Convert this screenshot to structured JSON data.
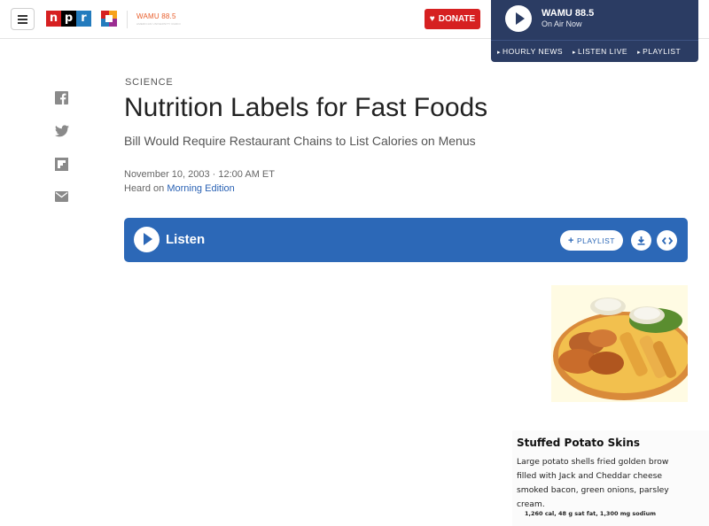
{
  "header": {
    "menu_icon": "hamburger-icon",
    "brand": {
      "n": "n",
      "p": "p",
      "r": "r"
    },
    "station_logo_text": "WAMU 88.5",
    "station_logo_tagline": "AMERICAN UNIVERSITY RADIO",
    "donate_label": "DONATE",
    "donate_icon": "heart-icon"
  },
  "player": {
    "station_name": "WAMU 88.5",
    "status": "On Air Now",
    "links": [
      "HOURLY NEWS",
      "LISTEN LIVE",
      "PLAYLIST"
    ]
  },
  "share": [
    "facebook-icon",
    "twitter-icon",
    "flipboard-icon",
    "email-icon"
  ],
  "article": {
    "slug": "SCIENCE",
    "title": "Nutrition Labels for Fast Foods",
    "subtitle": "Bill Would Require Restaurant Chains to List Calories on Menus",
    "date": "November 10, 2003 · 12:00 AM ET",
    "heard_on_prefix": "Heard on ",
    "heard_on_program": "Morning Edition"
  },
  "listen": {
    "label": "Listen",
    "playlist_label": "PLAYLIST",
    "download_icon": "download-icon",
    "embed_icon": "embed-icon"
  },
  "image": {
    "card_title": "Stuffed Potato Skins",
    "card_desc": "Large potato shells fried golden brow\nfilled with Jack and Cheddar cheese\nsmoked bacon, green onions, parsley\ncream.",
    "card_nutrition": "1,260 cal, 48 g sat fat, 1,300 mg sodium"
  },
  "colors": {
    "npr_red": "#d62021",
    "npr_blue": "#237bbd",
    "player_navy": "#2b3c63",
    "listen_blue": "#2c68b7",
    "link_blue": "#2a62b4"
  }
}
